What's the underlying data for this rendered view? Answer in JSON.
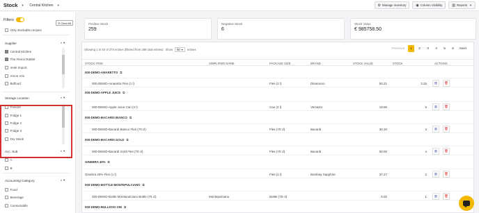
{
  "topbar": {
    "title": "Stock",
    "store": "Central Kitchen",
    "buttons": [
      {
        "label": "Manage Inventory",
        "icon": "gear-icon"
      },
      {
        "label": "Column Visibility",
        "icon": "eye-icon"
      },
      {
        "label": "Reports",
        "icon": "bar-chart-icon"
      }
    ]
  },
  "sidebar": {
    "filters_label": "Filters",
    "clear_all": "Clear All",
    "top_item": "Only stockable recipes",
    "supplier": {
      "title": "Supplier",
      "items": [
        "Central Kitchen",
        "The Fierce Rabbit",
        "4Ask Import",
        "Amon Aris",
        "Bidfood"
      ]
    },
    "storage": {
      "title": "Storage Location",
      "items": [
        "Freezer",
        "Fridge 1",
        "Fridge 2",
        "Fridge 3",
        "Dry Stock"
      ]
    },
    "acc_sub": {
      "title": "Acc. Sub",
      "items": [
        "A",
        "B"
      ]
    },
    "accounting": {
      "title": "Accounting Category",
      "items": [
        "Food",
        "Beverage",
        "Consumable"
      ]
    }
  },
  "cards": [
    {
      "label": "Positive Stock",
      "value": "259"
    },
    {
      "label": "Negative Stock",
      "value": "6"
    },
    {
      "label": "Stock Value",
      "value": "€ 985758.50"
    }
  ],
  "table": {
    "showing_prefix": "Showing 1 to 50 of 279 entries (filtered from 289 total entries)",
    "show_label": "Show",
    "show_value": "50",
    "entries_label": "entries",
    "pager": {
      "prev": "Previous",
      "pages": [
        "1",
        "2",
        "3",
        "4",
        "5",
        "6"
      ],
      "next": "Next"
    },
    "headers": {
      "stock_item": "Stock Item",
      "simplified": "Simplified Name",
      "package": "Package Size",
      "brand": "Brand",
      "stock_value": "Stock Value",
      "stock": "Stock",
      "actions": "Actions"
    },
    "groups": [
      {
        "name": "000-DEMO-AMARETTO",
        "item": "000-DEMO-Amaretto Fles (1 l)",
        "simplified": "",
        "package": "Fles (1 l)",
        "brand": "Disaronno",
        "value": "50.21",
        "stock": "3.25"
      },
      {
        "name": "000-DEMO-APPLE JUICE",
        "item": "000-DEMO-Apple Juice Can (2 l)",
        "simplified": "",
        "package": "Can (2 l)",
        "brand": "Vers&Zo",
        "value": "19.90",
        "stock": "5"
      },
      {
        "name": "000-DEMO-BACARDI BIANCO",
        "item": "000-DEMO-Bacardi Bianco Fles (70 cl)",
        "simplified": "",
        "package": "Fles (70 cl)",
        "brand": "Bacardi",
        "value": "30.30",
        "stock": "3"
      },
      {
        "name": "000-DEMO-BACARDI GOLD",
        "item": "000-DEMO-Bacardi Gold Fles (70 cl)",
        "simplified": "",
        "package": "Fles (70 cl)",
        "brand": "Bacardi",
        "value": "50.00",
        "stock": "4"
      },
      {
        "name": "GINEBRA 40%",
        "item": "Ginebra 40% Fles (1 l)",
        "simplified": "",
        "package": "Fles (1 l)",
        "brand": "Bombay Sapphire",
        "value": "37.27",
        "stock": "2"
      },
      {
        "name": "000-DEMO-BOTTLE-MONTEPULCIANO",
        "item": "000-DEMO-Bottle Montepulciano Bottle (75 cl)",
        "simplified": "Montepulciano",
        "package": "Bottle (75 cl)",
        "brand": "",
        "value": "5.00",
        "stock": "1"
      },
      {
        "name": "000-DEMO-BULLDOG GIN",
        "item": "",
        "simplified": "",
        "package": "",
        "brand": "",
        "value": "",
        "stock": ""
      }
    ]
  }
}
